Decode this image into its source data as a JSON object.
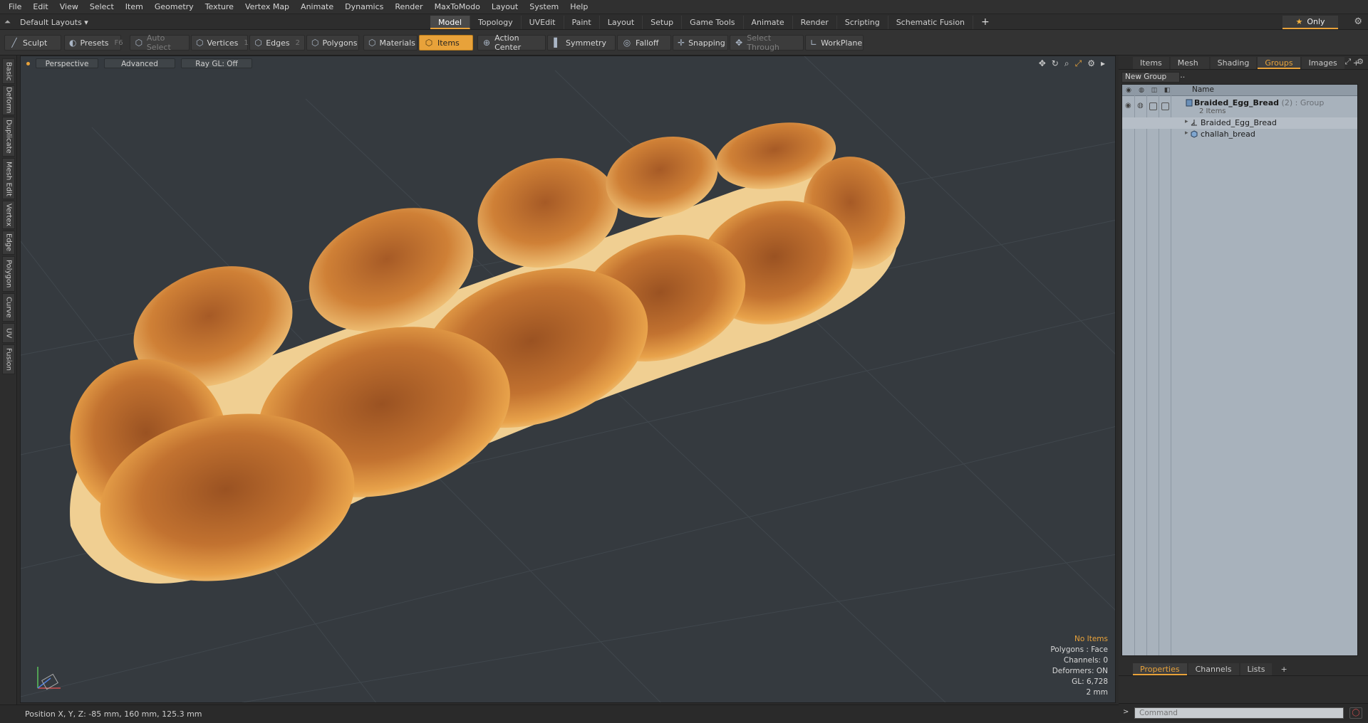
{
  "menu": [
    "File",
    "Edit",
    "View",
    "Select",
    "Item",
    "Geometry",
    "Texture",
    "Vertex Map",
    "Animate",
    "Dynamics",
    "Render",
    "MaxToModo",
    "Layout",
    "System",
    "Help"
  ],
  "layouts": {
    "label": "Default Layouts ▾"
  },
  "tabs": [
    "Model",
    "Topology",
    "UVEdit",
    "Paint",
    "Layout",
    "Setup",
    "Game Tools",
    "Animate",
    "Render",
    "Scripting",
    "Schematic Fusion"
  ],
  "tabs_active": "Model",
  "only_label": "Only",
  "toolbar": {
    "sculpt": "Sculpt",
    "presets": "Presets",
    "presets_key": "F6",
    "auto_select": "Auto Select",
    "vertices": "Vertices",
    "vertices_key": "1",
    "edges": "Edges",
    "edges_key": "2",
    "polygons": "Polygons",
    "materials": "Materials",
    "items": "Items",
    "action_center": "Action Center",
    "symmetry": "Symmetry",
    "falloff": "Falloff",
    "snapping": "Snapping",
    "select_through": "Select Through",
    "workplane": "WorkPlane"
  },
  "left_tabs": [
    "Basic",
    "Deform",
    "Duplicate",
    "Mesh Edit",
    "Vertex",
    "Edge",
    "Polygon",
    "Curve",
    "UV",
    "Fusion"
  ],
  "viewport": {
    "perspective": "Perspective",
    "advanced": "Advanced",
    "raygl": "Ray GL: Off",
    "info": {
      "items": "No Items",
      "polygons": "Polygons : Face",
      "channels": "Channels: 0",
      "deformers": "Deformers: ON",
      "gl": "GL: 6,728",
      "scale": "2 mm"
    }
  },
  "status": {
    "position": "Position X, Y, Z:  -85 mm, 160 mm, 125.3 mm"
  },
  "right_tabs": [
    "Items",
    "Mesh ...",
    "Shading",
    "Groups",
    "Images"
  ],
  "right_tabs_active": "Groups",
  "new_group": "New Group",
  "tree": {
    "name_header": "Name",
    "group_name": "Braided_Egg_Bread",
    "group_count": "(2)",
    "group_type": ": Group",
    "group_sub": "2 Items",
    "child1": "Braided_Egg_Bread",
    "child2": "challah_bread"
  },
  "bottom_tabs": [
    "Properties",
    "Channels",
    "Lists"
  ],
  "bottom_tabs_active": "Properties",
  "command_placeholder": "Command",
  "colors": {
    "accent": "#e8a23a",
    "viewport": "#353a3f",
    "tree_bg": "#a8b2bc"
  }
}
